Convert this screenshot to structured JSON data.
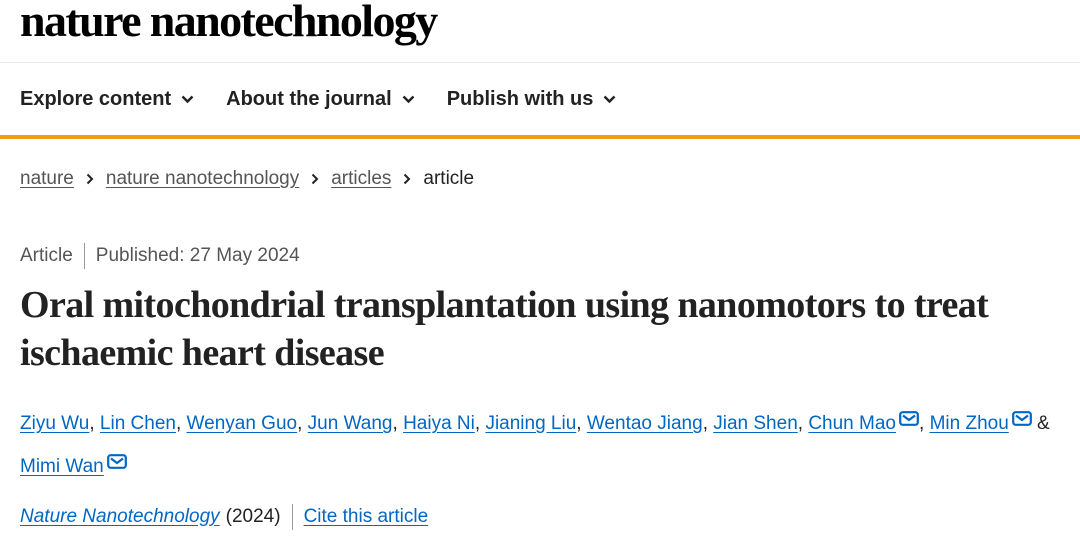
{
  "masthead": {
    "logo": "nature nanotechnology"
  },
  "nav": {
    "items": [
      {
        "label": "Explore content"
      },
      {
        "label": "About the journal"
      },
      {
        "label": "Publish with us"
      }
    ]
  },
  "breadcrumb": {
    "items": [
      "nature",
      "nature nanotechnology",
      "articles"
    ],
    "current": "article"
  },
  "article": {
    "type": "Article",
    "published": "Published: 27 May 2024",
    "title": "Oral mitochondrial transplantation using nanomotors to treat ischaemic heart disease",
    "authors": [
      {
        "name": "Ziyu Wu"
      },
      {
        "name": "Lin Chen"
      },
      {
        "name": "Wenyan Guo"
      },
      {
        "name": "Jun Wang"
      },
      {
        "name": "Haiya Ni"
      },
      {
        "name": "Jianing Liu"
      },
      {
        "name": "Wentao Jiang"
      },
      {
        "name": "Jian Shen"
      },
      {
        "name": "Chun Mao",
        "corresponding": true
      },
      {
        "name": "Min Zhou",
        "corresponding": true
      },
      {
        "name": "Mimi Wan",
        "corresponding": true
      }
    ],
    "authors_conjunction": "&",
    "journal": "Nature Nanotechnology",
    "year": "(2024)",
    "cite_label": "Cite this article"
  },
  "icons": {
    "nav_chevron": "chevron-down-icon",
    "breadcrumb_separator": "chevron-right-icon",
    "corresponding_author": "envelope-icon"
  },
  "colors": {
    "accent_bar": "#e9a20e",
    "link": "#0067c5",
    "text": "#222222",
    "muted": "#555555"
  }
}
